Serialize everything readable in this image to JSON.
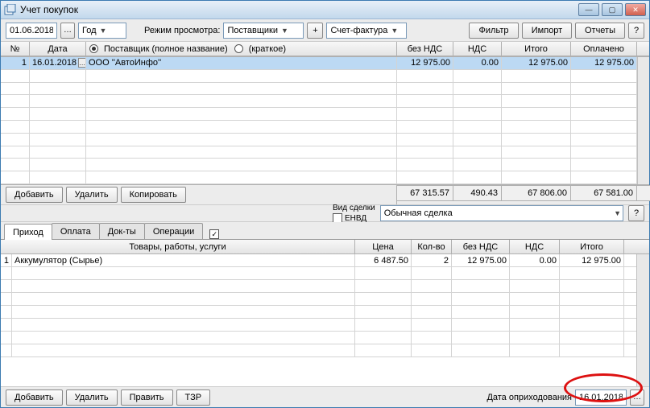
{
  "window": {
    "title": "Учет покупок"
  },
  "toolbar": {
    "date": "01.06.2018",
    "period": "Год",
    "view_mode_label": "Режим просмотра:",
    "view_mode": "Поставщики",
    "plus": "+",
    "doc_type": "Счет-фактура",
    "filter": "Фильтр",
    "import": "Импорт",
    "reports": "Отчеты",
    "help": "?"
  },
  "grid1_header": {
    "num": "№",
    "date": "Дата",
    "supplier_full_label": "Поставщик (полное название)",
    "supplier_short_label": "(краткое)",
    "no_vat": "без НДС",
    "vat": "НДС",
    "total": "Итого",
    "paid": "Оплачено"
  },
  "grid1_rows": [
    {
      "num": "1",
      "date": "16.01.2018",
      "supplier": "ООО ''АвтоИнфо''",
      "no_vat": "12 975.00",
      "vat": "0.00",
      "total": "12 975.00",
      "paid": "12 975.00"
    }
  ],
  "grid1_totals": {
    "no_vat": "67 315.57",
    "vat": "490.43",
    "total": "67 806.00",
    "paid": "67 581.00"
  },
  "mid": {
    "add": "Добавить",
    "delete": "Удалить",
    "copy": "Копировать"
  },
  "deal": {
    "type_label": "Вид сделки",
    "envd_label": "ЕНВД",
    "type_value": "Обычная сделка",
    "help": "?"
  },
  "tabs": {
    "incoming": "Приход",
    "payment": "Оплата",
    "docs": "Док-ты",
    "ops": "Операции"
  },
  "grid2_header": {
    "goods": "Товары, работы, услуги",
    "price": "Цена",
    "qty": "Кол-во",
    "no_vat": "без НДС",
    "vat": "НДС",
    "total": "Итого"
  },
  "grid2_rows": [
    {
      "num": "1",
      "goods": "Аккумулятор (Сырье)",
      "price": "6 487.50",
      "qty": "2",
      "no_vat": "12 975.00",
      "vat": "0.00",
      "total": "12 975.00"
    }
  ],
  "bottom": {
    "add": "Добавить",
    "delete": "Удалить",
    "edit": "Править",
    "tzr": "ТЗР",
    "posting_date_label": "Дата оприходования",
    "posting_date": "16.01.2018"
  }
}
